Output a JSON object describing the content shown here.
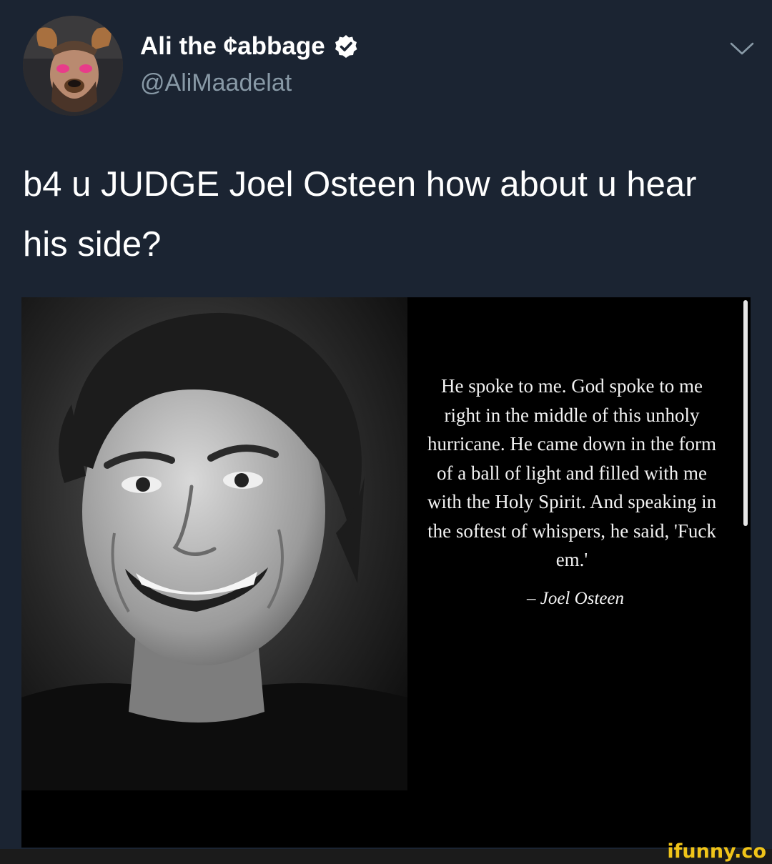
{
  "tweet": {
    "display_name": "Ali the ¢abbage",
    "handle": "@AliMaadelat",
    "text": "b4 u JUDGE Joel Osteen how about u hear his side?",
    "verified": true
  },
  "media": {
    "quote": "He spoke to me. God spoke to me right in the middle of this unholy hurricane. He came down in the form of a ball of light and filled with me with the Holy Spirit. And speaking in the softest of whispers, he said, 'Fuck em.'",
    "author": "– Joel Osteen"
  },
  "watermark": "ifunny.co",
  "icons": {
    "verified": "verified-badge-icon",
    "menu": "chevron-down-icon"
  },
  "colors": {
    "background": "#1b2432",
    "handle": "#8899a6",
    "watermark": "#f0c419"
  }
}
